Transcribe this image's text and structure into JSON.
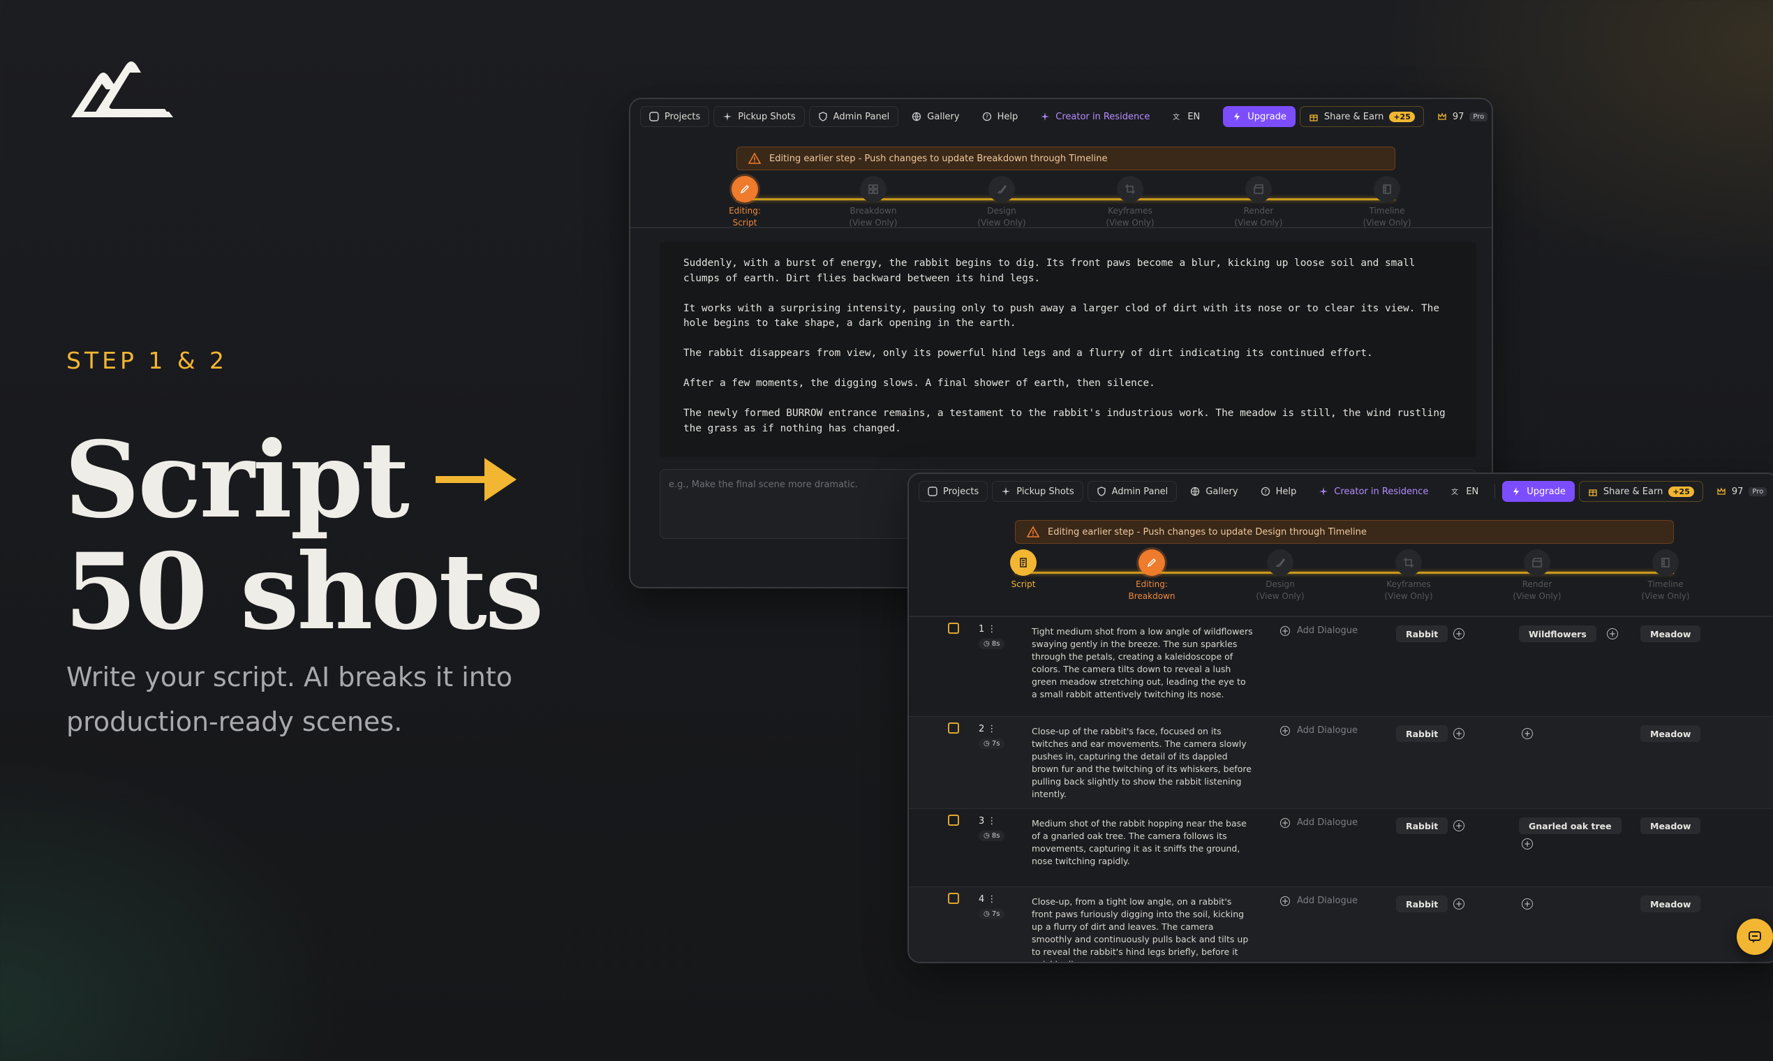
{
  "hero": {
    "step_label": "STEP 1 & 2",
    "headline_line1": "Script",
    "headline_line2": "50 shots",
    "subtitle": "Write your script. AI breaks it into production-ready scenes."
  },
  "colors": {
    "accent": "#f2b632",
    "active_step": "#ef7b2c",
    "upgrade": "#7c4dff",
    "creator": "#b48cff"
  },
  "nav": {
    "projects": "Projects",
    "pickup_shots": "Pickup Shots",
    "admin_panel": "Admin Panel",
    "gallery": "Gallery",
    "help": "Help",
    "creator": "Creator in Residence",
    "language": "EN",
    "upgrade": "Upgrade",
    "share": "Share & Earn",
    "share_badge": "+25",
    "credits": "97",
    "plan": "Pro"
  },
  "script_window": {
    "banner": "Editing earlier step - Push changes to update Breakdown through Timeline",
    "steps": [
      {
        "label": "Editing:",
        "sub": "Script",
        "icon": "pencil-icon"
      },
      {
        "label": "Breakdown",
        "sub": "(View Only)",
        "icon": "grid-icon"
      },
      {
        "label": "Design",
        "sub": "(View Only)",
        "icon": "brush-icon"
      },
      {
        "label": "Keyframes",
        "sub": "(View Only)",
        "icon": "crop-icon"
      },
      {
        "label": "Render",
        "sub": "(View Only)",
        "icon": "clapper-icon"
      },
      {
        "label": "Timeline",
        "sub": "(View Only)",
        "icon": "film-icon"
      }
    ],
    "paragraphs": [
      "Suddenly, with a burst of energy, the rabbit begins to dig. Its front paws become a blur, kicking up loose soil and small clumps of earth. Dirt flies backward between its hind legs.",
      "It works with a surprising intensity, pausing only to push away a larger clod of dirt with its nose or to clear its view. The hole begins to take shape, a dark opening in the earth.",
      "The rabbit disappears from view, only its powerful hind legs and a flurry of dirt indicating its continued effort.",
      "After a few moments, the digging slows. A final shower of earth, then silence.",
      "The newly formed BURROW entrance remains, a testament to the rabbit's industrious work. The meadow is still, the wind rustling the grass as if nothing has changed."
    ],
    "prompt_placeholder": "e.g., Make the final scene more dramatic."
  },
  "breakdown_window": {
    "banner": "Editing earlier step - Push changes to update Design through Timeline",
    "steps": [
      {
        "label": "Script",
        "sub": "",
        "icon": "script-icon"
      },
      {
        "label": "Editing:",
        "sub": "Breakdown",
        "icon": "pencil-icon"
      },
      {
        "label": "Design",
        "sub": "(View Only)",
        "icon": "brush-icon"
      },
      {
        "label": "Keyframes",
        "sub": "(View Only)",
        "icon": "crop-icon"
      },
      {
        "label": "Render",
        "sub": "(View Only)",
        "icon": "clapper-icon"
      },
      {
        "label": "Timeline",
        "sub": "(View Only)",
        "icon": "film-icon"
      }
    ],
    "add_dialogue": "Add Dialogue",
    "shots": [
      {
        "num": "1",
        "dur": "8s",
        "desc": "Tight medium shot from a low angle of wildflowers swaying gently in the breeze. The sun sparkles through the petals, creating a kaleidoscope of colors. The camera tilts down to reveal a lush green meadow stretching out, leading the eye to a small rabbit attentively twitching its nose.",
        "character": "Rabbit",
        "prop": "Wildflowers",
        "location": "Meadow"
      },
      {
        "num": "2",
        "dur": "7s",
        "desc": "Close-up of the rabbit's face, focused on its twitches and ear movements. The camera slowly pushes in, capturing the detail of its dappled brown fur and the twitching of its whiskers, before pulling back slightly to show the rabbit listening intently.",
        "character": "Rabbit",
        "prop": "",
        "location": "Meadow"
      },
      {
        "num": "3",
        "dur": "8s",
        "desc": "Medium shot of the rabbit hopping near the base of a gnarled oak tree. The camera follows its movements, capturing it as it sniffs the ground, nose twitching rapidly.",
        "character": "Rabbit",
        "prop": "Gnarled oak tree",
        "location": "Meadow"
      },
      {
        "num": "4",
        "dur": "7s",
        "desc": "Close-up, from a tight low angle, on a rabbit's front paws furiously digging into the soil, kicking up a flurry of dirt and leaves. The camera smoothly and continuously pulls back and tilts up to reveal the rabbit's hind legs briefly, before it quickly disappears",
        "character": "Rabbit",
        "prop": "",
        "location": "Meadow"
      }
    ]
  }
}
